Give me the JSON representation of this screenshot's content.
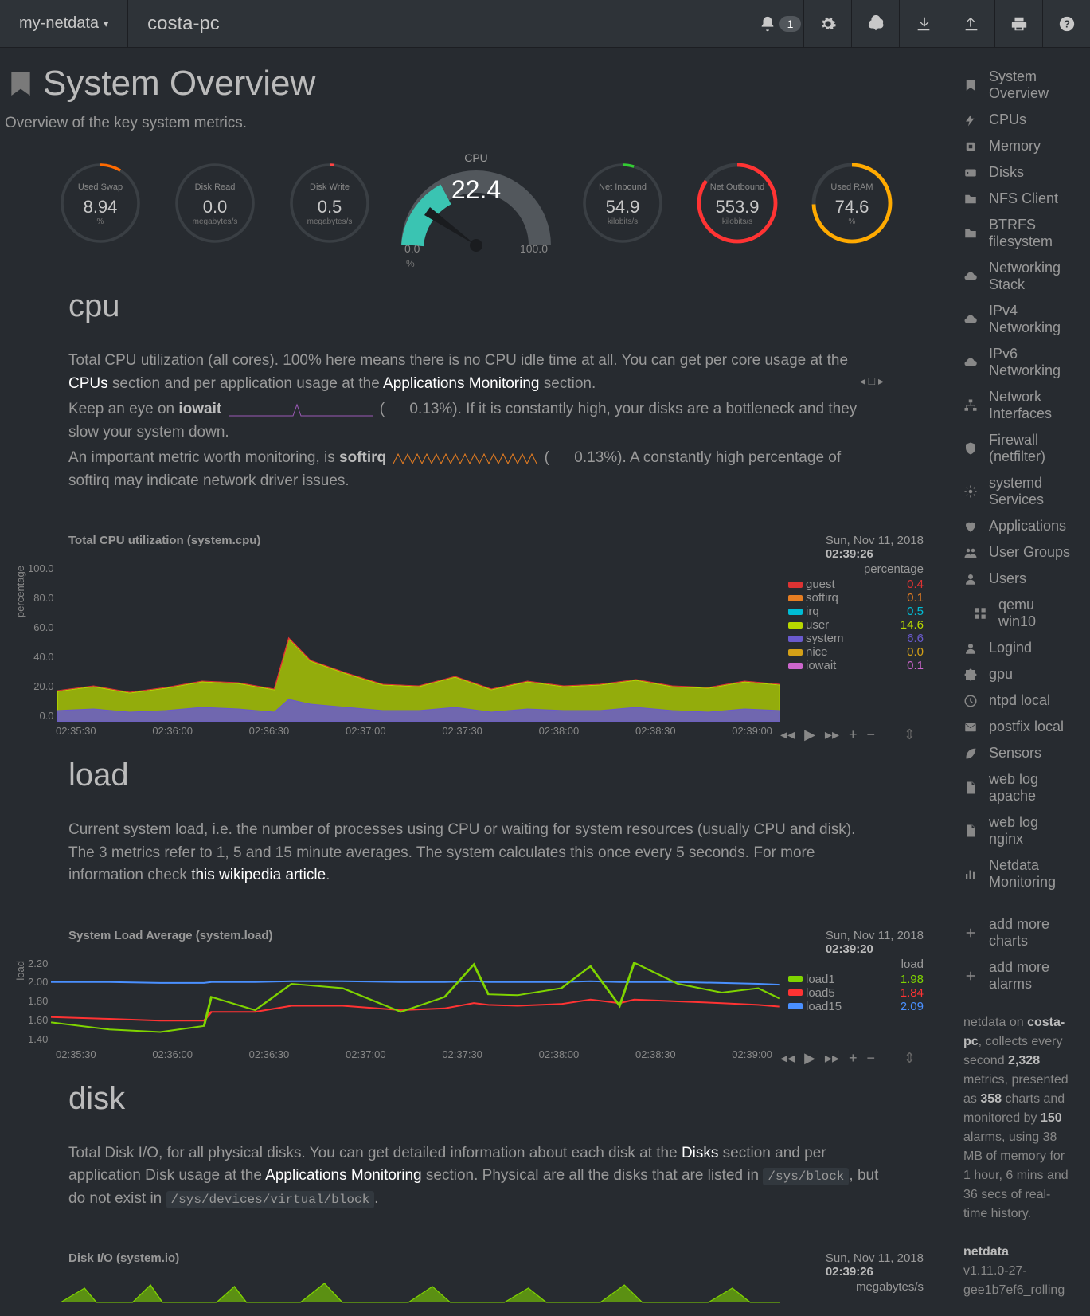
{
  "topbar": {
    "brand": "my-netdata",
    "host": "costa-pc",
    "alert_count": "1"
  },
  "page": {
    "title": "System Overview",
    "subtitle": "Overview of the key system metrics."
  },
  "gauges": {
    "swap": {
      "label": "Used Swap",
      "value": "8.94",
      "unit": "%",
      "color": "#ff6a00",
      "pct": 0.09
    },
    "dread": {
      "label": "Disk Read",
      "value": "0.0",
      "unit": "megabytes/s",
      "color": "#33aa33",
      "pct": 0.0
    },
    "dwrite": {
      "label": "Disk Write",
      "value": "0.5",
      "unit": "megabytes/s",
      "color": "#ff4444",
      "pct": 0.02
    },
    "cpu": {
      "label": "CPU",
      "value": "22.4",
      "min": "0.0",
      "max": "100.0",
      "pct": 0.224
    },
    "netin": {
      "label": "Net Inbound",
      "value": "54.9",
      "unit": "kilobits/s",
      "color": "#33cc33",
      "pct": 0.05
    },
    "netout": {
      "label": "Net Outbound",
      "value": "553.9",
      "unit": "kilobits/s",
      "color": "#ff3333",
      "pct": 0.85
    },
    "ram": {
      "label": "Used RAM",
      "value": "74.6",
      "unit": "%",
      "color": "#ffaa00",
      "pct": 0.746
    }
  },
  "cpu_section": {
    "heading": "cpu",
    "desc1_a": "Total CPU utilization (all cores). 100% here means there is no CPU idle time at all. You can get per core usage at the ",
    "desc1_link1": "CPUs",
    "desc1_b": " section and per application usage at the ",
    "desc1_link2": "Applications Monitoring",
    "desc1_c": " section.",
    "desc2_a": "Keep an eye on ",
    "desc2_b": "iowait",
    "desc2_c": " 0.13%). If it is constantly high, your disks are a bottleneck and they slow your system down.",
    "desc3_a": "An important metric worth monitoring, is ",
    "desc3_b": "softirq",
    "desc3_c": " 0.13%). A constantly high percentage of softirq may indicate network driver issues."
  },
  "load_section": {
    "heading": "load",
    "desc_a": "Current system load, i.e. the number of processes using CPU or waiting for system resources (usually CPU and disk). The 3 metrics refer to 1, 5 and 15 minute averages. The system calculates this once every 5 seconds. For more information check ",
    "desc_link": "this wikipedia article",
    "desc_b": "."
  },
  "disk_section": {
    "heading": "disk",
    "desc_a": "Total Disk I/O, for all physical disks. You can get detailed information about each disk at the ",
    "desc_link1": "Disks",
    "desc_b": " section and per application Disk usage at the ",
    "desc_link2": "Applications Monitoring",
    "desc_c": " section. Physical are all the disks that are listed in ",
    "desc_code1": "/sys/block",
    "desc_d": ", but do not exist in ",
    "desc_code2": "/sys/devices/virtual/block",
    "desc_e": "."
  },
  "chart_data": [
    {
      "id": "cpu-chart",
      "type": "area",
      "title": "Total CPU utilization (system.cpu)",
      "timestamp": "Sun, Nov 11, 2018",
      "time": "02:39:26",
      "ylabel": "percentage",
      "ylim": [
        0,
        100
      ],
      "yticks": [
        "100.0",
        "80.0",
        "60.0",
        "40.0",
        "20.0",
        "0.0"
      ],
      "xticks": [
        "02:35:30",
        "02:36:00",
        "02:36:30",
        "02:37:00",
        "02:37:30",
        "02:38:00",
        "02:38:30",
        "02:39:00"
      ],
      "legend_header": "percentage",
      "series": [
        {
          "name": "guest",
          "color": "#dd3333",
          "value": "0.4"
        },
        {
          "name": "softirq",
          "color": "#e67e22",
          "value": "0.1"
        },
        {
          "name": "irq",
          "color": "#00bcd4",
          "value": "0.5"
        },
        {
          "name": "user",
          "color": "#b8d800",
          "value": "14.6"
        },
        {
          "name": "system",
          "color": "#6a5acd",
          "value": "6.6"
        },
        {
          "name": "nice",
          "color": "#d4a017",
          "value": "0.0"
        },
        {
          "name": "iowait",
          "color": "#cc66cc",
          "value": "0.1"
        }
      ],
      "x": [
        0,
        0.05,
        0.1,
        0.15,
        0.2,
        0.25,
        0.3,
        0.32,
        0.35,
        0.4,
        0.45,
        0.5,
        0.55,
        0.6,
        0.65,
        0.7,
        0.75,
        0.8,
        0.85,
        0.9,
        0.95,
        1.0
      ],
      "total": [
        19,
        22,
        18,
        21,
        25,
        24,
        20,
        52,
        38,
        30,
        23,
        22,
        28,
        20,
        25,
        22,
        23,
        26,
        22,
        21,
        25,
        23
      ],
      "system_vals": [
        7,
        8,
        6,
        7,
        9,
        8,
        6,
        14,
        11,
        9,
        7,
        7,
        9,
        6,
        8,
        7,
        7,
        9,
        7,
        6,
        8,
        7
      ]
    },
    {
      "id": "load-chart",
      "type": "line",
      "title": "System Load Average (system.load)",
      "timestamp": "Sun, Nov 11, 2018",
      "time": "02:39:20",
      "ylabel": "load",
      "ylim": [
        1.4,
        2.4
      ],
      "yticks": [
        "2.20",
        "2.00",
        "1.80",
        "1.60",
        "1.40"
      ],
      "xticks": [
        "02:35:30",
        "02:36:00",
        "02:36:30",
        "02:37:00",
        "02:37:30",
        "02:38:00",
        "02:38:30",
        "02:39:00"
      ],
      "legend_header": "load",
      "series": [
        {
          "name": "load1",
          "color": "#7fd400",
          "value": "1.98"
        },
        {
          "name": "load5",
          "color": "#ff3333",
          "value": "1.84"
        },
        {
          "name": "load15",
          "color": "#4a90ff",
          "value": "2.09"
        }
      ],
      "x": [
        0,
        0.08,
        0.15,
        0.21,
        0.22,
        0.28,
        0.33,
        0.4,
        0.48,
        0.54,
        0.58,
        0.6,
        0.64,
        0.7,
        0.74,
        0.78,
        0.8,
        0.86,
        0.92,
        0.97,
        1.0
      ],
      "load1": [
        1.66,
        1.58,
        1.55,
        1.62,
        1.95,
        1.8,
        2.1,
        2.05,
        1.78,
        1.95,
        2.32,
        1.98,
        1.97,
        2.05,
        2.3,
        1.85,
        2.34,
        2.1,
        2.0,
        2.05,
        1.93
      ],
      "load5": [
        1.72,
        1.7,
        1.68,
        1.68,
        1.78,
        1.78,
        1.85,
        1.85,
        1.8,
        1.82,
        1.88,
        1.86,
        1.85,
        1.87,
        1.92,
        1.88,
        1.92,
        1.9,
        1.88,
        1.86,
        1.84
      ],
      "load15": [
        2.12,
        2.12,
        2.11,
        2.11,
        2.12,
        2.12,
        2.13,
        2.13,
        2.12,
        2.12,
        2.13,
        2.12,
        2.12,
        2.12,
        2.13,
        2.12,
        2.12,
        2.12,
        2.11,
        2.1,
        2.09
      ]
    },
    {
      "id": "disk-chart",
      "type": "area",
      "title": "Disk I/O (system.io)",
      "timestamp": "Sun, Nov 11, 2018",
      "time": "02:39:26",
      "ylabel": "megabytes/s",
      "legend_header": "megabytes/s"
    }
  ],
  "sidebar": {
    "items": [
      {
        "icon": "bookmark",
        "label": "System Overview"
      },
      {
        "icon": "bolt",
        "label": "CPUs"
      },
      {
        "icon": "chip",
        "label": "Memory"
      },
      {
        "icon": "hdd",
        "label": "Disks"
      },
      {
        "icon": "folder",
        "label": "NFS Client"
      },
      {
        "icon": "folder",
        "label": "BTRFS filesystem"
      },
      {
        "icon": "cloud",
        "label": "Networking Stack"
      },
      {
        "icon": "cloud",
        "label": "IPv4 Networking"
      },
      {
        "icon": "cloud",
        "label": "IPv6 Networking"
      },
      {
        "icon": "sitemap",
        "label": "Network Interfaces"
      },
      {
        "icon": "shield",
        "label": "Firewall (netfilter)"
      },
      {
        "icon": "cogs",
        "label": "systemd Services"
      },
      {
        "icon": "heart",
        "label": "Applications"
      },
      {
        "icon": "users",
        "label": "User Groups"
      },
      {
        "icon": "user",
        "label": "Users"
      },
      {
        "icon": "th",
        "label": "qemu win10",
        "indent": true
      },
      {
        "icon": "user",
        "label": "Logind"
      },
      {
        "icon": "puzzle",
        "label": "gpu"
      },
      {
        "icon": "clock",
        "label": "ntpd local"
      },
      {
        "icon": "envelope",
        "label": "postfix local"
      },
      {
        "icon": "leaf",
        "label": "Sensors"
      },
      {
        "icon": "file",
        "label": "web log apache"
      },
      {
        "icon": "file",
        "label": "web log nginx"
      },
      {
        "icon": "barchart",
        "label": "Netdata Monitoring"
      }
    ],
    "extras": [
      {
        "icon": "plus",
        "label": "add more charts"
      },
      {
        "icon": "plus",
        "label": "add more alarms"
      }
    ]
  },
  "footer": {
    "text1": "netdata on ",
    "host": "costa-pc",
    "text2": ", collects every second ",
    "metrics": "2,328",
    "text3": " metrics, presented as ",
    "charts": "358",
    "text4": " charts and monitored by ",
    "alarms": "150",
    "text5": " alarms, using 38 MB of memory for 1 hour, 6 mins and 36 secs of real-time history.",
    "product": "netdata",
    "version": "v1.11.0-27-gee1b7ef6_rolling"
  }
}
